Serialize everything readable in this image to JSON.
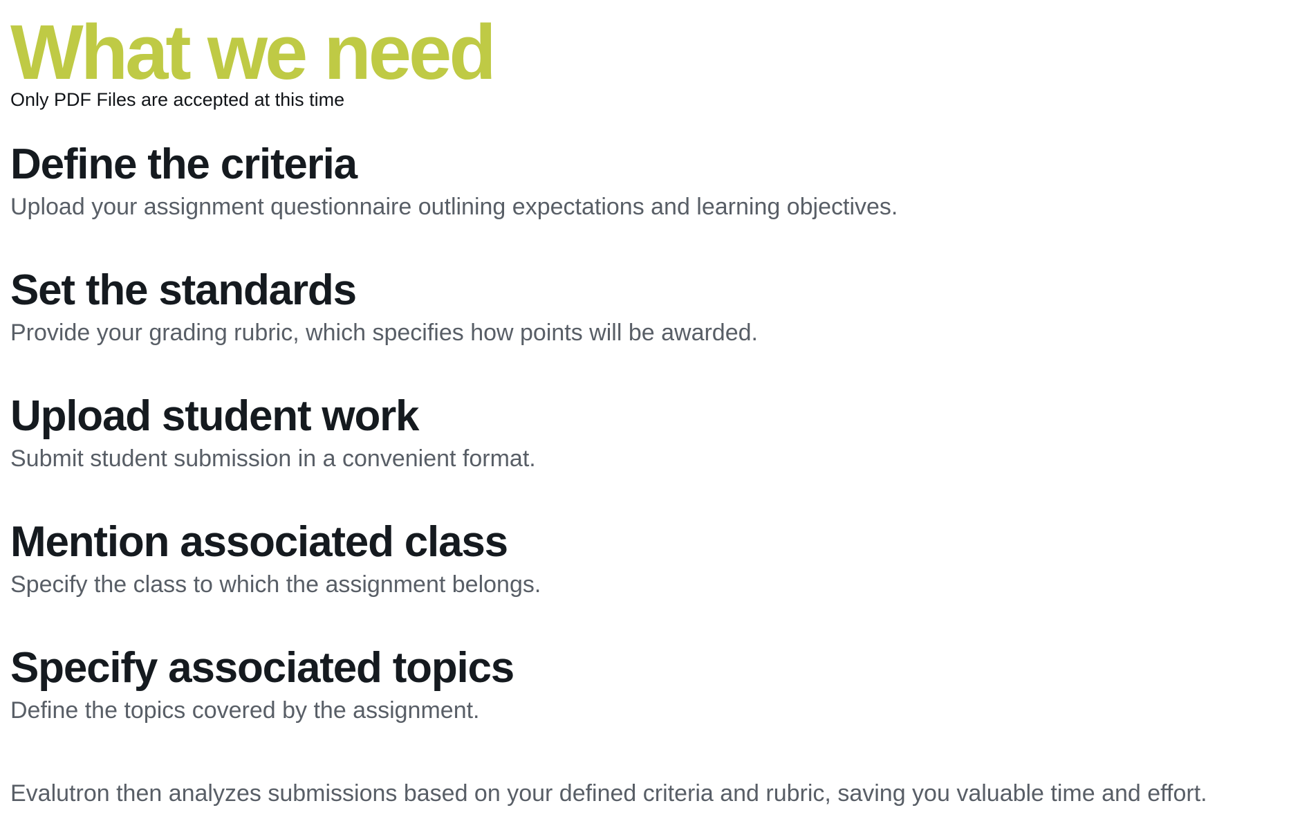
{
  "header": {
    "title": "What we need",
    "subtitle": "Only PDF Files are accepted at this time"
  },
  "requirements": [
    {
      "heading": "Define the criteria",
      "description": "Upload your assignment questionnaire outlining expectations and learning objectives."
    },
    {
      "heading": "Set the standards",
      "description": "Provide your grading rubric, which specifies how points will be awarded."
    },
    {
      "heading": "Upload student work",
      "description": "Submit student submission in a convenient format."
    },
    {
      "heading": "Mention associated class",
      "description": "Specify the class to which the assignment belongs."
    },
    {
      "heading": "Specify associated topics",
      "description": "Define the topics covered by the assignment."
    }
  ],
  "footer": {
    "note": "Evalutron then analyzes submissions based on your defined criteria and rubric, saving you valuable time and effort."
  },
  "colors": {
    "accent": "#bfca45",
    "heading": "#151a1f",
    "body_text": "#585e66"
  }
}
